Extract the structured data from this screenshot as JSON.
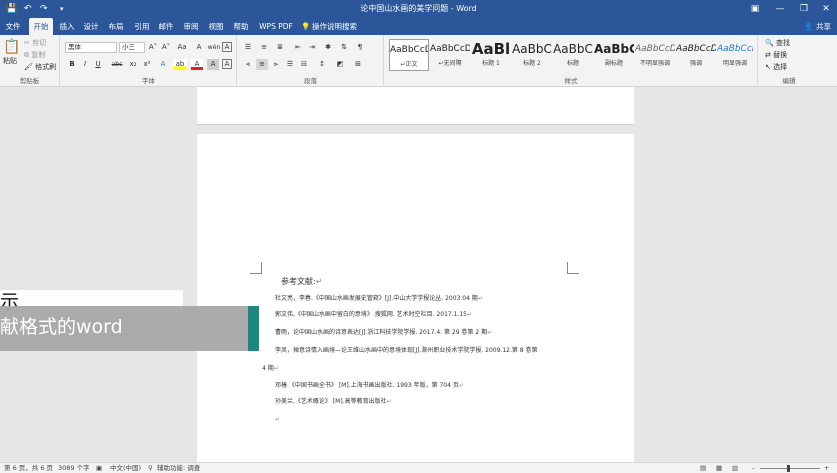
{
  "window": {
    "title": "论中国山水画的美学问题 - Word",
    "controls": {
      "minimize": "—",
      "restore": "❐",
      "close": "✕"
    },
    "quick_access": {
      "save": "💾",
      "undo": "↶",
      "redo": "↷",
      "more": "▾"
    }
  },
  "tabs": [
    {
      "label": "文件"
    },
    {
      "label": "开始"
    },
    {
      "label": "插入"
    },
    {
      "label": "设计"
    },
    {
      "label": "布局"
    },
    {
      "label": "引用"
    },
    {
      "label": "邮件"
    },
    {
      "label": "审阅"
    },
    {
      "label": "视图"
    },
    {
      "label": "帮助"
    },
    {
      "label": "WPS PDF"
    },
    {
      "label": "操作说明搜索"
    }
  ],
  "active_tab": "开始",
  "share_label": "共享",
  "ribbon": {
    "clipboard": {
      "label": "剪贴板",
      "paste": "粘贴",
      "cut": "剪切",
      "copy": "复制",
      "format_painter": "格式刷"
    },
    "font": {
      "label": "字体",
      "font_name": "黑体",
      "font_size": "小三",
      "grow": "A˄",
      "shrink": "A˅",
      "case": "Aa",
      "clear": "A",
      "phonetic": "wén",
      "enclose": "A",
      "bold": "B",
      "italic": "I",
      "underline": "U",
      "strike": "abc",
      "sub": "x₂",
      "sup": "x²",
      "effects": "A",
      "highlight": "ab",
      "color": "A",
      "shading": "A",
      "border": "A"
    },
    "paragraph": {
      "label": "段落"
    },
    "styles": {
      "label": "样式",
      "items": [
        {
          "preview": "AaBbCcDc",
          "name": "↵正文"
        },
        {
          "preview": "AaBbCcDc",
          "name": "↵无间隔"
        },
        {
          "preview": "AaBl",
          "name": "标题 1"
        },
        {
          "preview": "AaBbC",
          "name": "标题 2"
        },
        {
          "preview": "AaBbC",
          "name": "标题"
        },
        {
          "preview": "AaBbC",
          "name": "副标题"
        },
        {
          "preview": "AaBbCcD",
          "name": "不明显强调"
        },
        {
          "preview": "AaBbCcD",
          "name": "强调"
        },
        {
          "preview": "AaBbCcD",
          "name": "明显强调"
        }
      ]
    },
    "editing": {
      "label": "编辑",
      "find": "查找",
      "replace": "替换",
      "select": "选择"
    }
  },
  "document": {
    "heading": "参考文献:",
    "references": [
      "杜文亮，李春.《中国山水画发展史管窥》[J].中山大学学报论丛. 2003.04 期",
      "郭文伟,《中国山水画中留白的意境》.搜狐网. 艺术时空栏目. 2017.1.15",
      "曹雨，论中国山水画的诗意表达[J].浙江科技学院学报. 2017.4. 第 29 卷第 2 期",
      "李凤，禅意诗情入画境—论王维山水画中的意境体现[J].滁州职业技术学院学报. 2009.12.第 8 卷第",
      "4 期",
      "邓椿.《中国书画全书》 [M].上海书画出版社. 1993 年版，第 704 页",
      "孙美兰,《艺术概论》 [M].高等教育出版社"
    ],
    "paragraph_mark": "↵"
  },
  "overlay": {
    "line1": "示",
    "line2": "献格式的word"
  },
  "statusbar": {
    "page": "第 6 页，共 6 页",
    "words": "3089 个字",
    "lang": "中文(中国)",
    "accessibility": "辅助功能: 调查",
    "zoom_minus": "-",
    "zoom_plus": "+"
  },
  "colors": {
    "accent": "#2b579a",
    "teal": "#1a8a7e"
  }
}
